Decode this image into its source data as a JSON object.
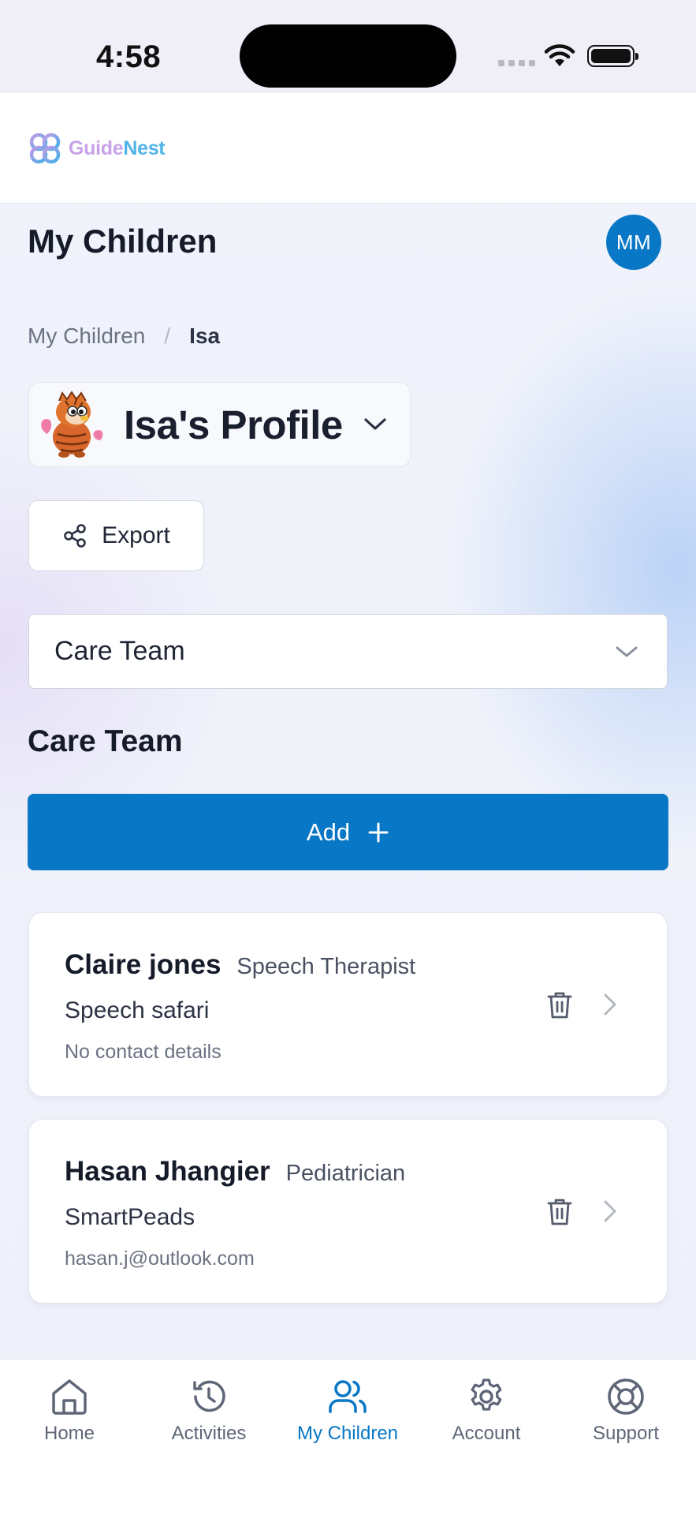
{
  "status_bar": {
    "time": "4:58"
  },
  "header": {
    "logo_guide": "Guide",
    "logo_nest": "Nest"
  },
  "page": {
    "title": "My Children",
    "avatar_initials": "MM"
  },
  "breadcrumb": {
    "parent": "My Children",
    "separator": "/",
    "current": "Isa"
  },
  "profile": {
    "name": "Isa's Profile"
  },
  "export_label": "Export",
  "section_select": {
    "selected": "Care Team"
  },
  "section_heading": "Care Team",
  "add_label": "Add",
  "care_team": [
    {
      "name": "Claire jones",
      "role": "Speech Therapist",
      "organization": "Speech safari",
      "contact": "No contact details"
    },
    {
      "name": "Hasan Jhangier",
      "role": "Pediatrician",
      "organization": "SmartPeads",
      "contact": "hasan.j@outlook.com"
    }
  ],
  "nav": [
    {
      "label": "Home",
      "icon": "home-icon"
    },
    {
      "label": "Activities",
      "icon": "history-icon"
    },
    {
      "label": "My Children",
      "icon": "users-icon"
    },
    {
      "label": "Account",
      "icon": "gear-icon"
    },
    {
      "label": "Support",
      "icon": "lifebuoy-icon"
    }
  ],
  "colors": {
    "primary": "#0877c5",
    "text": "#161b2a",
    "muted": "#6b7384"
  }
}
